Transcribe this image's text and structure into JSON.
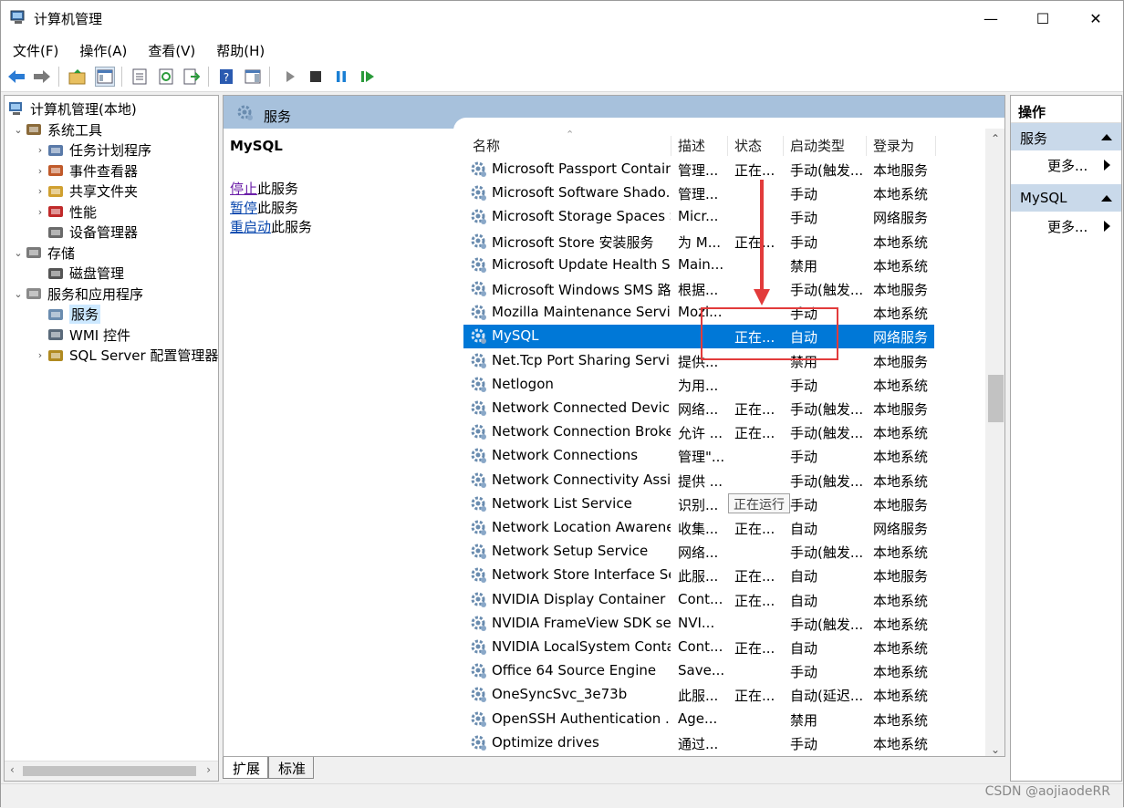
{
  "window": {
    "title": "计算机管理",
    "minimize": "—",
    "maximize": "☐",
    "close": "✕"
  },
  "menu": [
    "文件(F)",
    "操作(A)",
    "查看(V)",
    "帮助(H)"
  ],
  "tree": {
    "root": "计算机管理(本地)",
    "items": [
      {
        "label": "系统工具",
        "level": 1,
        "expander": "⌄"
      },
      {
        "label": "任务计划程序",
        "level": 2,
        "expander": "›"
      },
      {
        "label": "事件查看器",
        "level": 2,
        "expander": "›"
      },
      {
        "label": "共享文件夹",
        "level": 2,
        "expander": "›"
      },
      {
        "label": "性能",
        "level": 2,
        "expander": "›"
      },
      {
        "label": "设备管理器",
        "level": 2,
        "expander": ""
      },
      {
        "label": "存储",
        "level": 1,
        "expander": "⌄"
      },
      {
        "label": "磁盘管理",
        "level": 2,
        "expander": ""
      },
      {
        "label": "服务和应用程序",
        "level": 1,
        "expander": "⌄"
      },
      {
        "label": "服务",
        "level": 2,
        "expander": "",
        "selected": true
      },
      {
        "label": "WMI 控件",
        "level": 2,
        "expander": ""
      },
      {
        "label": "SQL Server 配置管理器",
        "level": 2,
        "expander": "›"
      }
    ]
  },
  "panel": {
    "header": "服务",
    "selected_name": "MySQL",
    "actions": [
      {
        "link": "停止",
        "rest": "此服务",
        "visited": true
      },
      {
        "link": "暂停",
        "rest": "此服务",
        "visited": false
      },
      {
        "link": "重启动",
        "rest": "此服务",
        "visited": false
      }
    ]
  },
  "columns": [
    "名称",
    "描述",
    "状态",
    "启动类型",
    "登录为"
  ],
  "services": [
    {
      "name": "Microsoft Passport Container",
      "desc": "管理...",
      "status": "正在...",
      "startup": "手动(触发...",
      "logon": "本地服务"
    },
    {
      "name": "Microsoft Software Shado...",
      "desc": "管理...",
      "status": "",
      "startup": "手动",
      "logon": "本地系统"
    },
    {
      "name": "Microsoft Storage Spaces S...",
      "desc": "Micr...",
      "status": "",
      "startup": "手动",
      "logon": "网络服务"
    },
    {
      "name": "Microsoft Store 安装服务",
      "desc": "为 M...",
      "status": "正在...",
      "startup": "手动",
      "logon": "本地系统"
    },
    {
      "name": "Microsoft Update Health S...",
      "desc": "Main...",
      "status": "",
      "startup": "禁用",
      "logon": "本地系统"
    },
    {
      "name": "Microsoft Windows SMS 路...",
      "desc": "根据...",
      "status": "",
      "startup": "手动(触发...",
      "logon": "本地服务"
    },
    {
      "name": "Mozilla Maintenance Service",
      "desc": "Mozi...",
      "status": "",
      "startup": "手动",
      "logon": "本地系统"
    },
    {
      "name": "MySQL",
      "desc": "",
      "status": "正在...",
      "startup": "自动",
      "logon": "网络服务",
      "selected": true
    },
    {
      "name": "Net.Tcp Port Sharing Service",
      "desc": "提供...",
      "status": "",
      "startup": "禁用",
      "logon": "本地服务"
    },
    {
      "name": "Netlogon",
      "desc": "为用...",
      "status": "",
      "startup": "手动",
      "logon": "本地系统"
    },
    {
      "name": "Network Connected Devic...",
      "desc": "网络...",
      "status": "正在...",
      "startup": "手动(触发...",
      "logon": "本地服务"
    },
    {
      "name": "Network Connection Broker",
      "desc": "允许 ...",
      "status": "正在...",
      "startup": "手动(触发...",
      "logon": "本地系统"
    },
    {
      "name": "Network Connections",
      "desc": "管理\"...",
      "status": "",
      "startup": "手动",
      "logon": "本地系统"
    },
    {
      "name": "Network Connectivity Assis...",
      "desc": "提供 ...",
      "status": "",
      "startup": "手动(触发...",
      "logon": "本地系统"
    },
    {
      "name": "Network List Service",
      "desc": "识别...",
      "status": "",
      "startup": "手动",
      "logon": "本地服务"
    },
    {
      "name": "Network Location Awarene...",
      "desc": "收集...",
      "status": "正在...",
      "startup": "自动",
      "logon": "网络服务"
    },
    {
      "name": "Network Setup Service",
      "desc": "网络...",
      "status": "",
      "startup": "手动(触发...",
      "logon": "本地系统"
    },
    {
      "name": "Network Store Interface Se...",
      "desc": "此服...",
      "status": "正在...",
      "startup": "自动",
      "logon": "本地服务"
    },
    {
      "name": "NVIDIA Display Container LS",
      "desc": "Cont...",
      "status": "正在...",
      "startup": "自动",
      "logon": "本地系统"
    },
    {
      "name": "NVIDIA FrameView SDK se...",
      "desc": "NVI...",
      "status": "",
      "startup": "手动(触发...",
      "logon": "本地系统"
    },
    {
      "name": "NVIDIA LocalSystem Conta...",
      "desc": "Cont...",
      "status": "正在...",
      "startup": "自动",
      "logon": "本地系统"
    },
    {
      "name": "Office 64 Source Engine",
      "desc": "Save...",
      "status": "",
      "startup": "手动",
      "logon": "本地系统"
    },
    {
      "name": "OneSyncSvc_3e73b",
      "desc": "此服...",
      "status": "正在...",
      "startup": "自动(延迟...",
      "logon": "本地系统"
    },
    {
      "name": "OpenSSH Authentication ...",
      "desc": "Age...",
      "status": "",
      "startup": "禁用",
      "logon": "本地系统"
    },
    {
      "name": "Optimize drives",
      "desc": "通过...",
      "status": "",
      "startup": "手动",
      "logon": "本地系统"
    }
  ],
  "tooltip": "正在运行",
  "tabs": [
    "扩展",
    "标准"
  ],
  "actions_pane": {
    "title": "操作",
    "sections": [
      {
        "label": "服务",
        "more": "更多..."
      },
      {
        "label": "MySQL",
        "more": "更多..."
      }
    ]
  },
  "watermark": "CSDN @aojiaodeRR",
  "colors": {
    "selection": "#0078d7",
    "header": "#a7c1dc",
    "annotation": "#e23b3b"
  }
}
